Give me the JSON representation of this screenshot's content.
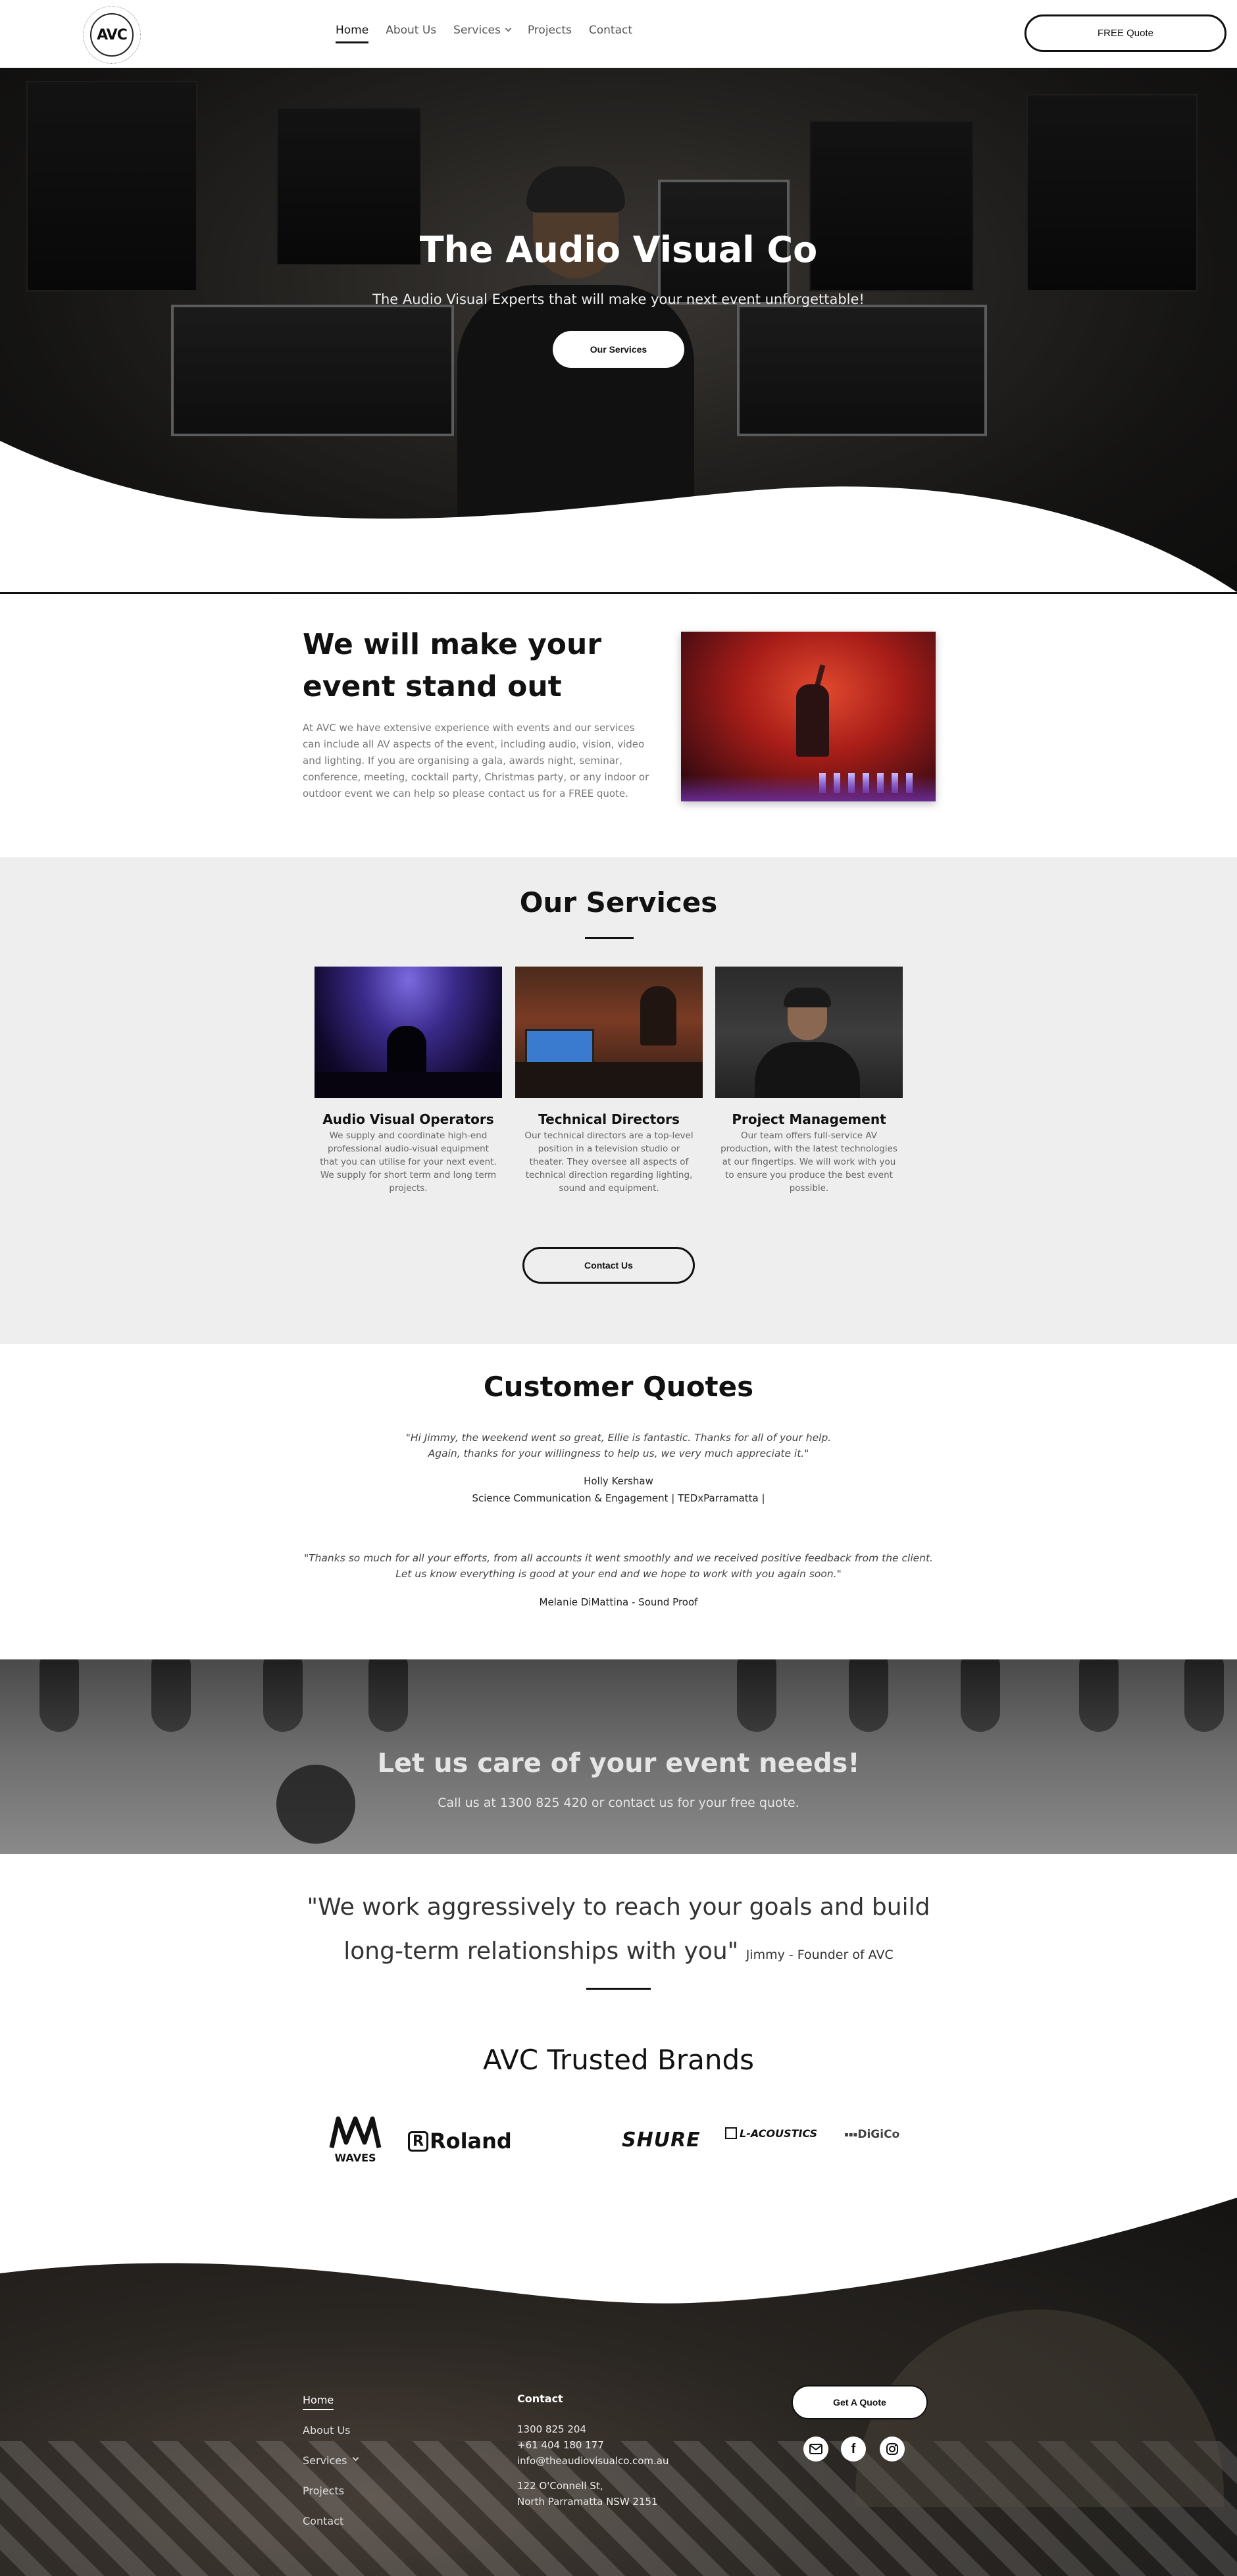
{
  "nav": {
    "logo_text": "AVC",
    "links": [
      {
        "label": "Home",
        "active": true
      },
      {
        "label": "About Us"
      },
      {
        "label": "Services",
        "has_dropdown": true
      },
      {
        "label": "Projects"
      },
      {
        "label": "Contact"
      }
    ],
    "cta_label": "FREE Quote"
  },
  "hero": {
    "title": "The Audio Visual Co",
    "subtitle": "The Audio Visual Experts that will make your next event unforgettable!",
    "button_label": "Our Services"
  },
  "intro": {
    "title_line1": "We will make your",
    "title_line2": "event stand out",
    "body": "At AVC we have extensive experience with events and our services can include all AV aspects of the event, including audio, vision, video and lighting. If you are organising a gala, awards night, seminar, conference, meeting, cocktail party, Christmas party, or any indoor or outdoor event we can help so please contact us for a FREE quote."
  },
  "services": {
    "title": "Our Services",
    "cards": [
      {
        "title": "Audio Visual Operators",
        "body": "We supply and coordinate high-end professional audio-visual equipment that you can utilise for your next event. We supply for short term and long term projects."
      },
      {
        "title": "Technical Directors",
        "body": "Our technical directors are a top-level position in a television studio or theater. They oversee all aspects of technical direction regarding lighting, sound and equipment."
      },
      {
        "title": "Project Management",
        "body": "Our team offers full-service AV production, with the latest technologies at our fingertips. We will work with you to ensure you produce the best event possible."
      }
    ],
    "button_label": "Contact Us"
  },
  "quotes": {
    "title": "Customer Quotes",
    "items": [
      {
        "line1": "\"Hi Jimmy, the weekend went so great, Ellie is fantastic. Thanks for all of your help.",
        "line2": "Again, thanks for your willingness to help us, we very much appreciate it.\"",
        "name": "Holly Kershaw",
        "org": "Science Communication & Engagement | TEDxParramatta |"
      },
      {
        "line1": "\"Thanks so much for all your efforts, from all accounts it went smoothly and we received positive feedback from the client.",
        "line2": "Let us know everything is good at your end and we hope to work with you again soon.\"",
        "name": "Melanie DiMattina - Sound Proof"
      }
    ]
  },
  "cta": {
    "title": "Let us care of your event needs!",
    "subtitle": "Call us at 1300 825 420 or contact us for your free quote."
  },
  "founder": {
    "line1": "\"We work aggressively to reach your goals and build",
    "line2": "long-term relationships with you\"",
    "attribution": "Jimmy - Founder of AVC"
  },
  "brands": {
    "title": "AVC Trusted Brands",
    "items": [
      "WAVES",
      "Roland",
      "SHURE",
      "L-ACOUSTICS",
      "DiGiCo"
    ]
  },
  "footer": {
    "links": [
      {
        "label": "Home",
        "active": true
      },
      {
        "label": "About Us"
      },
      {
        "label": "Services",
        "has_dropdown": true
      },
      {
        "label": "Projects"
      },
      {
        "label": "Contact"
      }
    ],
    "contact_heading": "Contact",
    "phone1": "1300 825 204",
    "phone2": "+61 404 180 177",
    "email": "info@theaudiovisualco.com.au",
    "address1": "122 O'Connell St,",
    "address2": "North Parramatta NSW 2151",
    "button_label": "Get A Quote",
    "social_icons": [
      "email-icon",
      "facebook-icon",
      "instagram-icon"
    ]
  }
}
